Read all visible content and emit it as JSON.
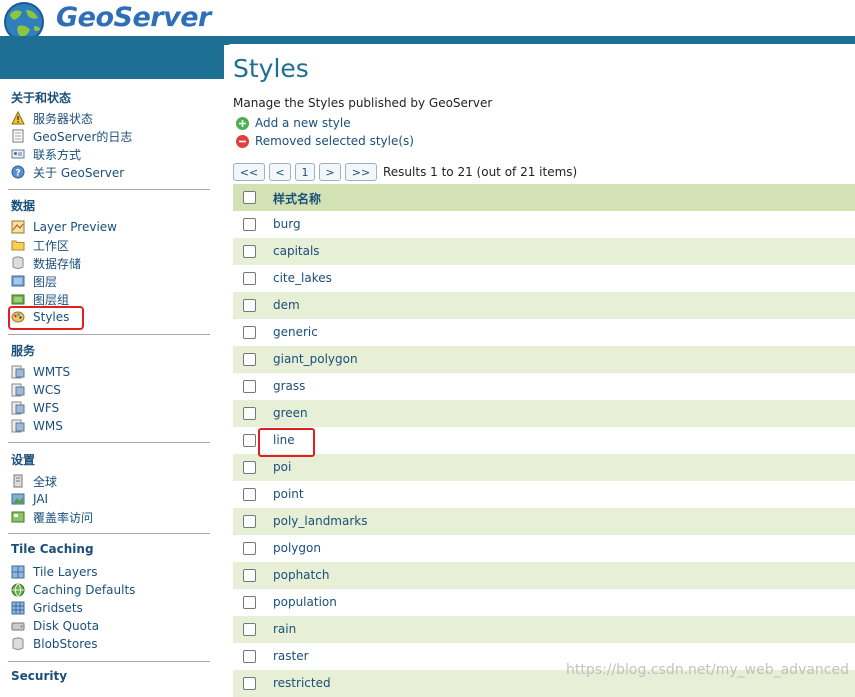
{
  "app": {
    "name": "GeoServer"
  },
  "sidebar": {
    "sections": [
      {
        "title": "关于和状态",
        "items": [
          {
            "label": "服务器状态",
            "icon": "warning-icon"
          },
          {
            "label": "GeoServer的日志",
            "icon": "document-icon"
          },
          {
            "label": "联系方式",
            "icon": "contact-card-icon"
          },
          {
            "label": "关于 GeoServer",
            "icon": "help-icon"
          }
        ]
      },
      {
        "title": "数据",
        "items": [
          {
            "label": "Layer Preview",
            "icon": "map-preview-icon"
          },
          {
            "label": "工作区",
            "icon": "folder-icon"
          },
          {
            "label": "数据存储",
            "icon": "database-icon"
          },
          {
            "label": "图层",
            "icon": "layer-icon"
          },
          {
            "label": "图层组",
            "icon": "layer-group-icon"
          },
          {
            "label": "Styles",
            "icon": "palette-icon"
          }
        ]
      },
      {
        "title": "服务",
        "items": [
          {
            "label": "WMTS",
            "icon": "service-icon"
          },
          {
            "label": "WCS",
            "icon": "service-icon"
          },
          {
            "label": "WFS",
            "icon": "service-icon"
          },
          {
            "label": "WMS",
            "icon": "service-icon"
          }
        ]
      },
      {
        "title": "设置",
        "items": [
          {
            "label": "全球",
            "icon": "server-icon"
          },
          {
            "label": "JAI",
            "icon": "image-icon"
          },
          {
            "label": "覆盖率访问",
            "icon": "coverage-icon"
          }
        ]
      },
      {
        "title": "Tile Caching",
        "items": [
          {
            "label": "Tile Layers",
            "icon": "grid-icon"
          },
          {
            "label": "Caching Defaults",
            "icon": "globe-icon"
          },
          {
            "label": "Gridsets",
            "icon": "grid-icon"
          },
          {
            "label": "Disk Quota",
            "icon": "disk-icon"
          },
          {
            "label": "BlobStores",
            "icon": "database-icon"
          }
        ]
      },
      {
        "title": "Security",
        "items": []
      }
    ]
  },
  "main": {
    "title": "Styles",
    "description": "Manage the Styles published by GeoServer",
    "actions": {
      "add": "Add a new style",
      "remove": "Removed selected style(s)"
    },
    "pager": {
      "first": "<<",
      "prev": "<",
      "page": "1",
      "next": ">",
      "last": ">>",
      "results": "Results 1 to 21 (out of 21 items)"
    },
    "table": {
      "header": "样式名称",
      "rows": [
        "burg",
        "capitals",
        "cite_lakes",
        "dem",
        "generic",
        "giant_polygon",
        "grass",
        "green",
        "line",
        "poi",
        "point",
        "poly_landmarks",
        "polygon",
        "pophatch",
        "population",
        "rain",
        "raster",
        "restricted"
      ]
    }
  },
  "colors": {
    "accent": "#1e6f94",
    "link": "#1a4f7a",
    "row_alt": "#e7efd6",
    "header_row": "#d2e2b4",
    "highlight": "#e02020"
  },
  "watermark": "https://blog.csdn.net/my_web_advanced"
}
